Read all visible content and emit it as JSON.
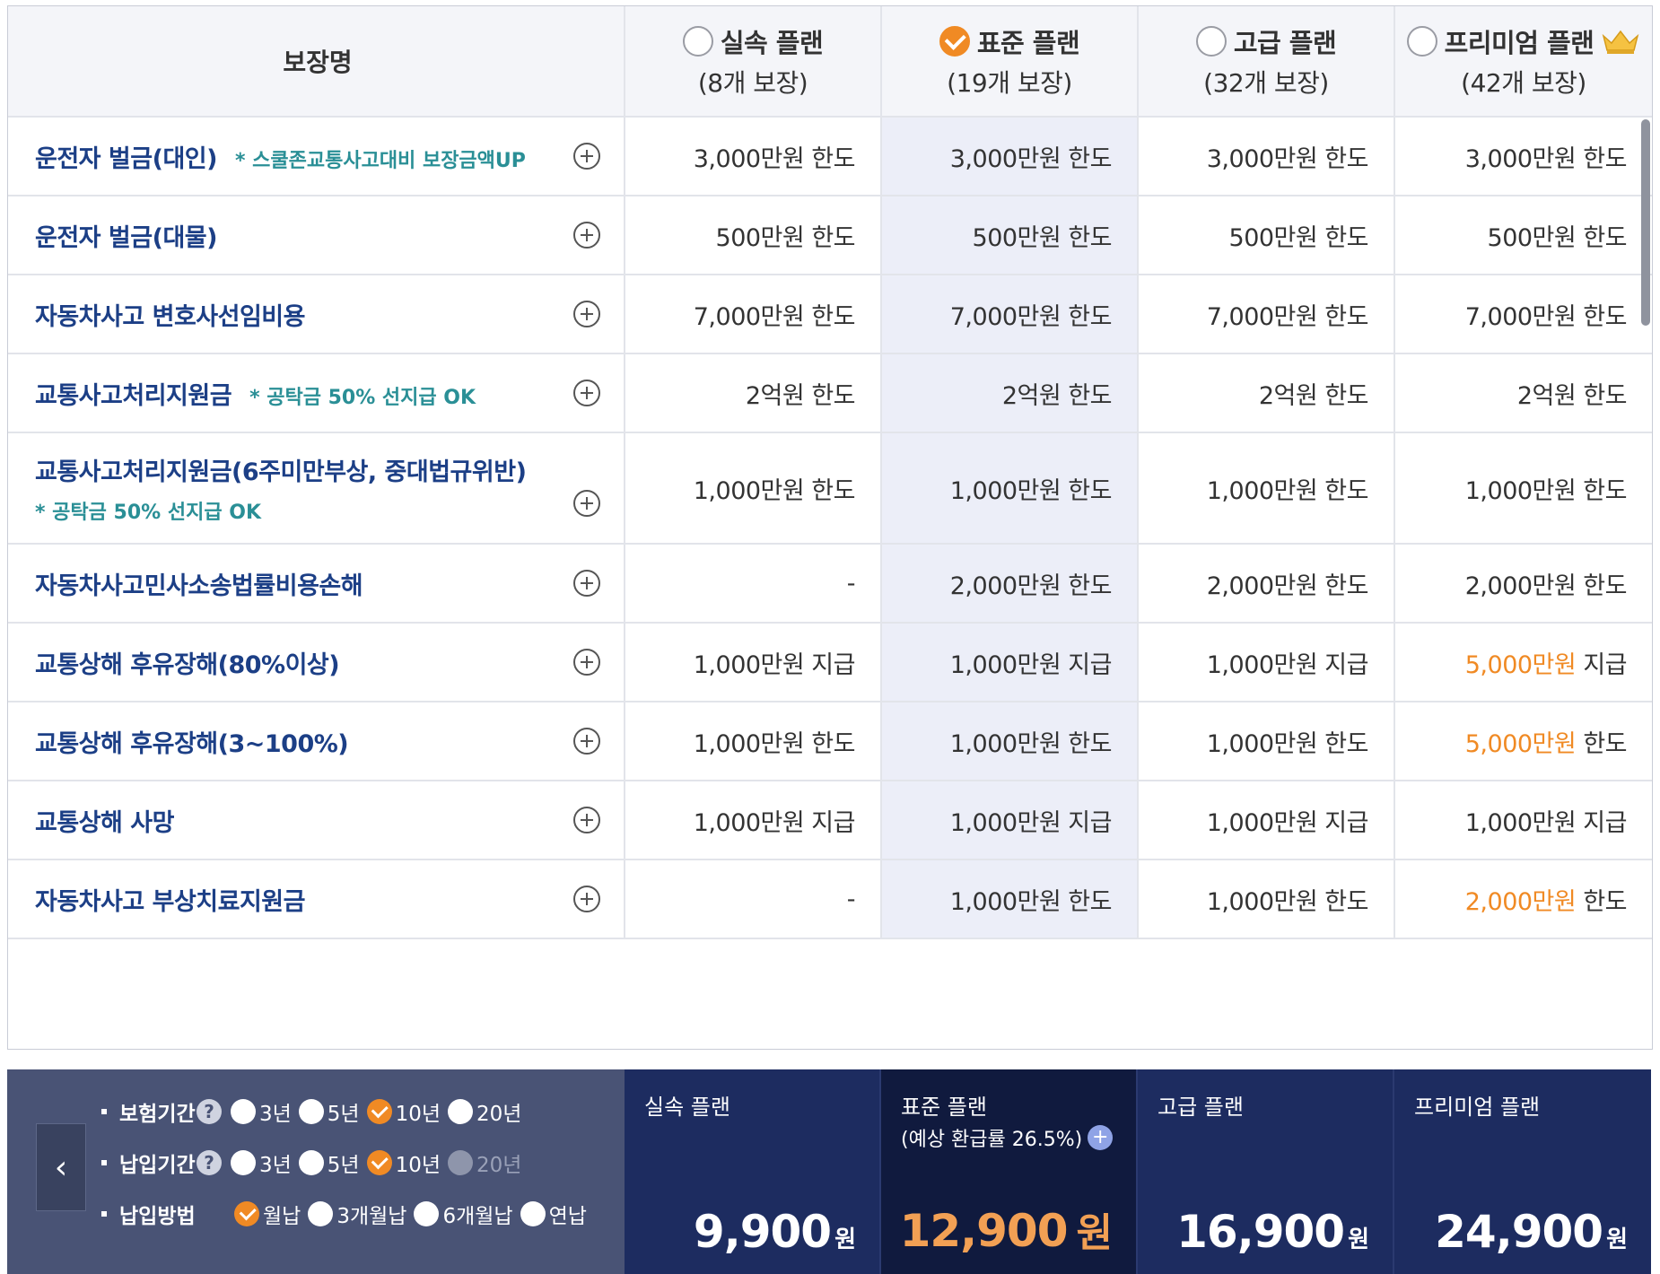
{
  "header": {
    "coverage_col": "보장명",
    "plans": [
      {
        "title": "실속 플랜",
        "sub": "(8개 보장)",
        "selected": false,
        "crown": false
      },
      {
        "title": "표준 플랜",
        "sub": "(19개 보장)",
        "selected": true,
        "crown": false
      },
      {
        "title": "고급 플랜",
        "sub": "(32개 보장)",
        "selected": false,
        "crown": false
      },
      {
        "title": "프리미엄 플랜",
        "sub": "(42개 보장)",
        "selected": false,
        "crown": true
      }
    ]
  },
  "rows": [
    {
      "name": "운전자 벌금(대인)",
      "note": "* 스쿨존교통사고대비 보장금액UP",
      "note_below": false,
      "values": [
        [
          "3,000만원 한도",
          ""
        ],
        [
          "3,000만원 한도",
          ""
        ],
        [
          "3,000만원 한도",
          ""
        ],
        [
          "3,000만원 한도",
          ""
        ]
      ]
    },
    {
      "name": "운전자 벌금(대물)",
      "note": "",
      "note_below": false,
      "values": [
        [
          "500만원 한도",
          ""
        ],
        [
          "500만원 한도",
          ""
        ],
        [
          "500만원 한도",
          ""
        ],
        [
          "500만원 한도",
          ""
        ]
      ]
    },
    {
      "name": "자동차사고 변호사선임비용",
      "note": "",
      "note_below": false,
      "values": [
        [
          "7,000만원 한도",
          ""
        ],
        [
          "7,000만원 한도",
          ""
        ],
        [
          "7,000만원 한도",
          ""
        ],
        [
          "7,000만원 한도",
          ""
        ]
      ]
    },
    {
      "name": "교통사고처리지원금",
      "note": "* 공탁금 50% 선지급 OK",
      "note_below": false,
      "values": [
        [
          "2억원 한도",
          ""
        ],
        [
          "2억원 한도",
          ""
        ],
        [
          "2억원 한도",
          ""
        ],
        [
          "2억원 한도",
          ""
        ]
      ]
    },
    {
      "name": "교통사고처리지원금(6주미만부상, 중대법규위반)",
      "note": "* 공탁금 50% 선지급 OK",
      "note_below": true,
      "values": [
        [
          "1,000만원 한도",
          ""
        ],
        [
          "1,000만원 한도",
          ""
        ],
        [
          "1,000만원 한도",
          ""
        ],
        [
          "1,000만원 한도",
          ""
        ]
      ]
    },
    {
      "name": "자동차사고민사소송법률비용손해",
      "note": "",
      "note_below": false,
      "values": [
        [
          "-",
          ""
        ],
        [
          "2,000만원 한도",
          ""
        ],
        [
          "2,000만원 한도",
          ""
        ],
        [
          "2,000만원 한도",
          ""
        ]
      ]
    },
    {
      "name": "교통상해 후유장해(80%이상)",
      "note": "",
      "note_below": false,
      "values": [
        [
          "1,000만원 지급",
          ""
        ],
        [
          "1,000만원 지급",
          ""
        ],
        [
          "1,000만원 지급",
          ""
        ],
        [
          "5,000만원",
          " 지급"
        ]
      ]
    },
    {
      "name": "교통상해 후유장해(3~100%)",
      "note": "",
      "note_below": false,
      "values": [
        [
          "1,000만원 한도",
          ""
        ],
        [
          "1,000만원 한도",
          ""
        ],
        [
          "1,000만원 한도",
          ""
        ],
        [
          "5,000만원",
          " 한도"
        ]
      ]
    },
    {
      "name": "교통상해 사망",
      "note": "",
      "note_below": false,
      "values": [
        [
          "1,000만원 지급",
          ""
        ],
        [
          "1,000만원 지급",
          ""
        ],
        [
          "1,000만원 지급",
          ""
        ],
        [
          "1,000만원 지급",
          ""
        ]
      ]
    },
    {
      "name": "자동차사고 부상치료지원금",
      "note": "",
      "note_below": false,
      "values": [
        [
          "-",
          ""
        ],
        [
          "1,000만원 한도",
          ""
        ],
        [
          "1,000만원 한도",
          ""
        ],
        [
          "2,000만원",
          " 한도"
        ]
      ]
    }
  ],
  "highlight_color": "#f08a24",
  "options": {
    "back_icon": "chevron-left-icon",
    "insurance_period": {
      "label": "보험기간",
      "choices": [
        {
          "text": "3년",
          "on": false,
          "disabled": false
        },
        {
          "text": "5년",
          "on": false,
          "disabled": false
        },
        {
          "text": "10년",
          "on": true,
          "disabled": false
        },
        {
          "text": "20년",
          "on": false,
          "disabled": false
        }
      ]
    },
    "payment_period": {
      "label": "납입기간",
      "choices": [
        {
          "text": "3년",
          "on": false,
          "disabled": false
        },
        {
          "text": "5년",
          "on": false,
          "disabled": false
        },
        {
          "text": "10년",
          "on": true,
          "disabled": false
        },
        {
          "text": "20년",
          "on": false,
          "disabled": true
        }
      ]
    },
    "payment_method": {
      "label": "납입방법",
      "choices": [
        {
          "text": "월납",
          "on": true,
          "disabled": false
        },
        {
          "text": "3개월납",
          "on": false,
          "disabled": false
        },
        {
          "text": "6개월납",
          "on": false,
          "disabled": false
        },
        {
          "text": "연납",
          "on": false,
          "disabled": false
        }
      ]
    }
  },
  "prices": [
    {
      "name": "실속 플랜",
      "sub": "",
      "amount": "9,900",
      "unit": "원"
    },
    {
      "name": "표준 플랜",
      "sub": "(예상 환급률 26.5%)",
      "amount": "12,900",
      "unit": "원"
    },
    {
      "name": "고급 플랜",
      "sub": "",
      "amount": "16,900",
      "unit": "원"
    },
    {
      "name": "프리미엄 플랜",
      "sub": "",
      "amount": "24,900",
      "unit": "원"
    }
  ]
}
